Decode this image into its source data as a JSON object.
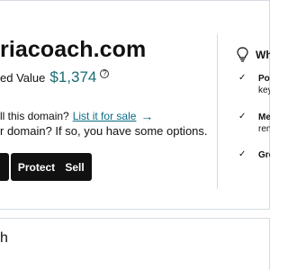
{
  "domain": {
    "name": "riacoach.com",
    "value_label": "ed Value",
    "value_amount": "$1,374",
    "info_icon": "question-circle-icon"
  },
  "sell_prompt": {
    "text": "ll this domain?",
    "link_label": "List it for sale",
    "arrow_icon": "arrow-right-icon"
  },
  "options_text": "r domain? If so, you have some options.",
  "buttons": {
    "protect_label": "Protect",
    "sell_label": "Sell"
  },
  "side_panel": {
    "title": "Wh",
    "icon": "lightbulb-icon",
    "items": [
      {
        "line1": "Pop",
        "line2": "key"
      },
      {
        "line1": "Me",
        "line2": "ren"
      },
      {
        "line1": "Gre",
        "line2": ""
      }
    ]
  },
  "lower_section": {
    "title": "h"
  },
  "colors": {
    "accent_value": "#1b6b73",
    "link": "#0a6d86",
    "button_bg": "#111111",
    "border": "#d4dbe0"
  }
}
